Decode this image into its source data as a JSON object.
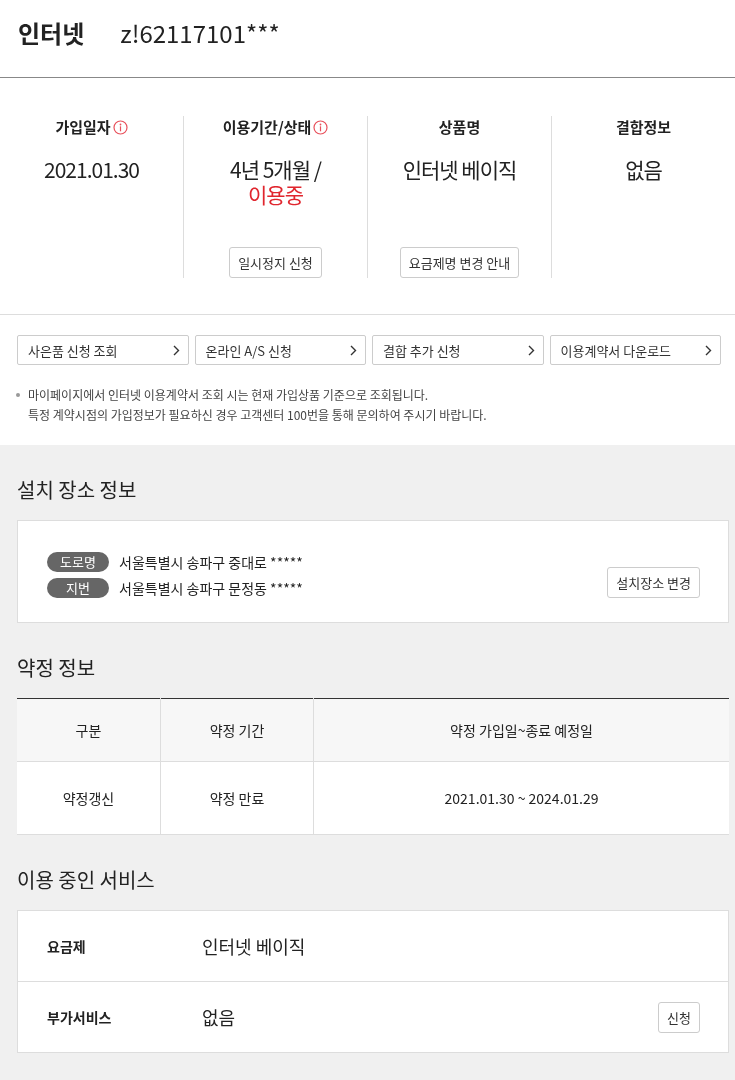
{
  "header": {
    "title": "인터넷",
    "account": "z!62117101***"
  },
  "summary": [
    {
      "label": "가입일자",
      "info": true,
      "values": [
        {
          "text": "2021.01.30",
          "kind": "normal"
        }
      ]
    },
    {
      "label": "이용기간/상태",
      "info": true,
      "values": [
        {
          "text": "4년 5개월 /",
          "kind": "normal"
        },
        {
          "text": "이용중",
          "kind": "alert"
        }
      ],
      "button": "일시정지 신청"
    },
    {
      "label": "상품명",
      "info": false,
      "values": [
        {
          "text": "인터넷 베이직",
          "kind": "normal"
        }
      ],
      "button": "요금제명 변경 안내"
    },
    {
      "label": "결합정보",
      "info": false,
      "values": [
        {
          "text": "없음",
          "kind": "normal"
        }
      ]
    }
  ],
  "links": [
    "사은품 신청 조회",
    "온라인 A/S 신청",
    "결합 추가 신청",
    "이용계약서 다운로드"
  ],
  "notes": [
    "마이페이지에서 인터넷 이용계약서 조회 시는 현재 가입상품 기준으로 조회됩니다.\n특정 계약시점의 가입정보가 필요하신 경우 고객센터 100번을 통해 문의하여 주시기 바랍니다."
  ],
  "install": {
    "title": "설치 장소 정보",
    "addresses": [
      {
        "tag": "도로명",
        "text": "서울특별시 송파구 중대로 *****"
      },
      {
        "tag": "지번",
        "text": "서울특별시 송파구 문정동 *****"
      }
    ],
    "button": "설치장소 변경"
  },
  "contract": {
    "title": "약정 정보",
    "columns": [
      "구분",
      "약정 기간",
      "약정 가입일~종료 예정일"
    ],
    "rows": [
      [
        "약정갱신",
        "약정 만료",
        "2021.01.30 ~ 2024.01.29"
      ]
    ]
  },
  "services": {
    "title": "이용 중인 서비스",
    "rows": [
      {
        "label": "요금제",
        "value": "인터넷 베이직"
      },
      {
        "label": "부가서비스",
        "value": "없음",
        "button": "신청"
      }
    ]
  }
}
